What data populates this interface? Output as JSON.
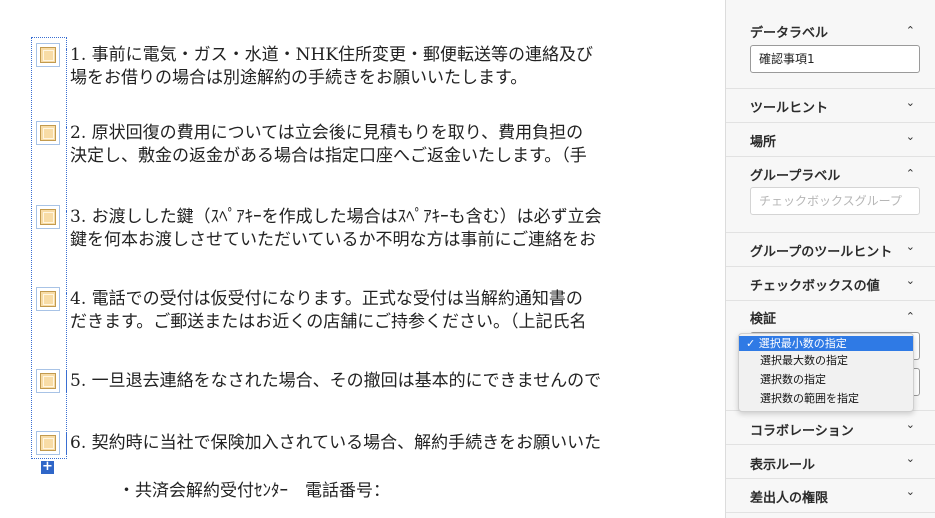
{
  "document": {
    "items": [
      {
        "lines": [
          "1. 事前に電気・ガス・水道・NHK住所変更・郵便転送等の連絡及び",
          "場をお借りの場合は別途解約の手続きをお願いいたします。"
        ]
      },
      {
        "lines": [
          "2. 原状回復の費用については立会後に見積もりを取り、費用負担の",
          "決定し、敷金の返金がある場合は指定口座へご返金いたします。（手"
        ]
      },
      {
        "lines": [
          "3. お渡しした鍵（ｽﾍﾟｱｷｰを作成した場合はｽﾍﾟｱｷｰも含む）は必ず立会",
          "鍵を何本お渡しさせていただいているか不明な方は事前にご連絡をお"
        ]
      },
      {
        "lines": [
          "4. 電話での受付は仮受付になります。正式な受付は当解約通知書の",
          "だきます。ご郵送またはお近くの店舗にご持参ください。（上記氏名"
        ]
      },
      {
        "lines": [
          "5. 一旦退去連絡をなされた場合、その撤回は基本的にできませんので"
        ]
      },
      {
        "lines": [
          "6. 契約時に当社で保険加入されている場合、解約手続きをお願いいた"
        ]
      }
    ],
    "footer": "・共済会解約受付ｾﾝﾀｰ　電話番号：",
    "add_button": "+"
  },
  "panel": {
    "data_label": {
      "title": "データラベル",
      "value": "確認事項1"
    },
    "tooltip": {
      "title": "ツールヒント"
    },
    "location": {
      "title": "場所"
    },
    "group_label": {
      "title": "グループラベル",
      "placeholder": "チェックボックスグループ"
    },
    "group_tooltip": {
      "title": "グループのツールヒント"
    },
    "checkbox_value": {
      "title": "チェックボックスの値"
    },
    "validation": {
      "title": "検証",
      "options": [
        "選択最小数の指定",
        "選択最大数の指定",
        "選択数の指定",
        "選択数の範囲を指定"
      ],
      "selected_index": 0,
      "check": "✓"
    },
    "collaboration": {
      "title": "コラボレーション"
    },
    "display_rules": {
      "title": "表示ルール"
    },
    "sender_permissions": {
      "title": "差出人の権限"
    },
    "chevron_up": "⌃",
    "chevron_down": "⌄"
  }
}
